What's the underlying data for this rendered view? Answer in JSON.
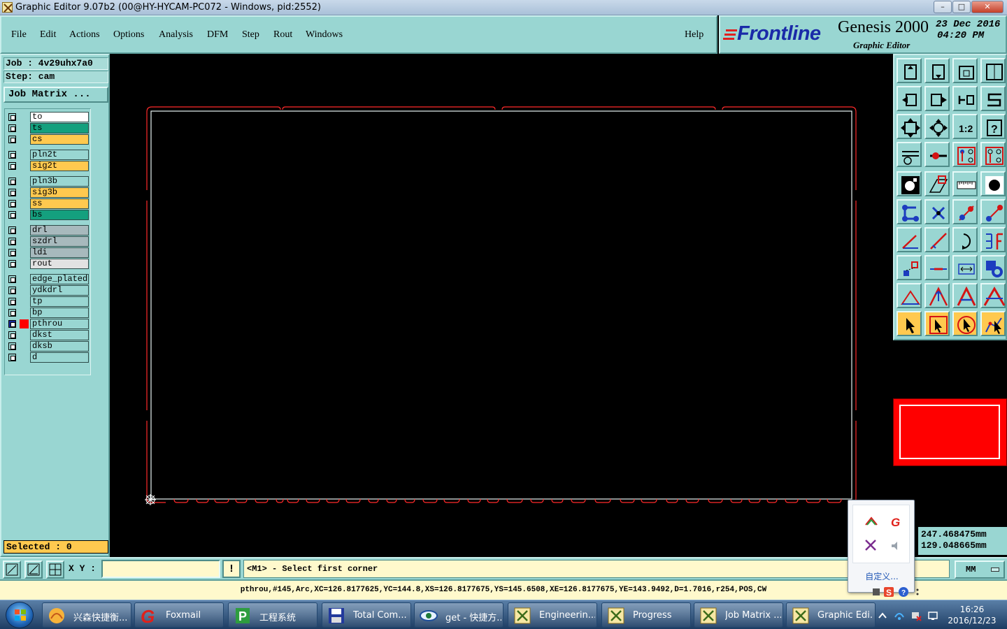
{
  "window": {
    "title": "Graphic Editor 9.07b2 (00@HY-HYCAM-PC072 - Windows, pid:2552)",
    "min_label": "–",
    "max_label": "□",
    "close_label": "✕"
  },
  "menu": {
    "items": [
      {
        "label": "File",
        "key": "F"
      },
      {
        "label": "Edit",
        "key": "E"
      },
      {
        "label": "Actions",
        "key": "A"
      },
      {
        "label": "Options",
        "key": "O"
      },
      {
        "label": "Analysis",
        "key": "n"
      },
      {
        "label": "DFM",
        "key": ""
      },
      {
        "label": "Step",
        "key": "S"
      },
      {
        "label": "Rout",
        "key": "R"
      },
      {
        "label": "Windows",
        "key": "W"
      }
    ],
    "help": "Help"
  },
  "logo": {
    "brand": "Frontline",
    "product": "Genesis 2000",
    "subtitle": "Graphic Editor",
    "date": "23 Dec 2016",
    "time": "04:20 PM"
  },
  "job": {
    "job_label": "Job : 4v29uhx7a0",
    "step_label": "Step: cam",
    "matrix_button": "Job Matrix ..."
  },
  "layers": [
    {
      "name": "to",
      "color": "#ffffff",
      "active": false
    },
    {
      "name": "ts",
      "color": "#14a07e",
      "active": false
    },
    {
      "name": "cs",
      "color": "#ffc94f",
      "active": false
    },
    {
      "name": "pln2t",
      "color": "#99d6d2",
      "active": false
    },
    {
      "name": "sig2t",
      "color": "#ffc94f",
      "active": false
    },
    {
      "name": "pln3b",
      "color": "#99d6d2",
      "active": false
    },
    {
      "name": "sig3b",
      "color": "#ffc94f",
      "active": false
    },
    {
      "name": "ss",
      "color": "#ffc94f",
      "active": false
    },
    {
      "name": "bs",
      "color": "#14a07e",
      "active": false
    },
    {
      "name": "drl",
      "color": "#a7b9bd",
      "active": false
    },
    {
      "name": "szdrl",
      "color": "#a7b9bd",
      "active": false
    },
    {
      "name": "ldi",
      "color": "#a7b9bd",
      "active": false
    },
    {
      "name": "rout",
      "color": "#e2e2e2",
      "active": false
    },
    {
      "name": "edge_plated",
      "color": "#99d6d2",
      "active": false
    },
    {
      "name": "ydkdrl",
      "color": "#99d6d2",
      "active": false
    },
    {
      "name": "tp",
      "color": "#99d6d2",
      "active": false
    },
    {
      "name": "bp",
      "color": "#99d6d2",
      "active": false
    },
    {
      "name": "pthrou",
      "color": "#99d6d2",
      "active": true
    },
    {
      "name": "dkst",
      "color": "#99d6d2",
      "active": false
    },
    {
      "name": "dksb",
      "color": "#99d6d2",
      "active": false
    },
    {
      "name": "d",
      "color": "#99d6d2",
      "active": false
    }
  ],
  "selected": "Selected : 0",
  "coords": {
    "x": "247.468475mm",
    "y": "129.048665mm"
  },
  "command": {
    "xy_label": "X Y :",
    "input_value": "",
    "bang": "!",
    "prompt": "<M1> - Select first corner",
    "units": "MM"
  },
  "info_line": "pthrou,#145,Arc,XC=126.8177625,YC=144.8,XS=126.8177675,YS=145.6508,XE=126.8177675,YE=143.9492,D=1.7016,r254,POS,CW",
  "tray_popup": {
    "custom": "自定义..."
  },
  "taskbar": {
    "tasks": [
      {
        "label": "兴森快捷衡...",
        "icon": "shell-icon"
      },
      {
        "label": "Foxmail",
        "icon": "foxmail-icon"
      },
      {
        "label": "工程系统",
        "icon": "engineering-system-icon"
      },
      {
        "label": "Total Com...",
        "icon": "floppy-icon"
      },
      {
        "label": "get - 快捷方...",
        "icon": "eye-icon"
      },
      {
        "label": "Engineerin...",
        "icon": "genesis-icon"
      },
      {
        "label": "Progress",
        "icon": "genesis-icon"
      },
      {
        "label": "Job Matrix ...",
        "icon": "genesis-icon"
      },
      {
        "label": "Graphic Edi...",
        "icon": "genesis-icon"
      }
    ],
    "time": "16:26",
    "date": "2016/12/23"
  },
  "colors": {
    "panel": "#99d6d2",
    "outline_red": "#ff2a2a",
    "profile_white": "#e8f4f4",
    "accent_yellow": "#ffc94f"
  }
}
